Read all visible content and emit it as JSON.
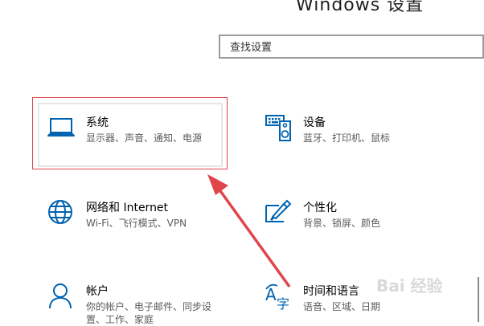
{
  "header": {
    "title": "Windows 设置"
  },
  "search": {
    "placeholder": "查找设置"
  },
  "tiles": [
    {
      "title": "系统",
      "desc": "显示器、声音、通知、电源",
      "icon": "laptop-icon"
    },
    {
      "title": "设备",
      "desc": "蓝牙、打印机、鼠标",
      "icon": "keyboard-speaker-icon"
    },
    {
      "title": "网络和 Internet",
      "desc": "Wi-Fi、飞行模式、VPN",
      "icon": "globe-icon"
    },
    {
      "title": "个性化",
      "desc": "背景、锁屏、颜色",
      "icon": "paint-brush-icon"
    },
    {
      "title": "帐户",
      "desc": "你的帐户、电子邮件、同步设",
      "desc2": "置、工作、家庭",
      "icon": "person-icon"
    },
    {
      "title": "时间和语言",
      "desc": "语音、区域、日期",
      "icon": "time-language-icon"
    }
  ],
  "annotation": {
    "color": "#e0454a"
  },
  "accent": "#0063b1",
  "watermark": {
    "text": "Bai 经验"
  }
}
